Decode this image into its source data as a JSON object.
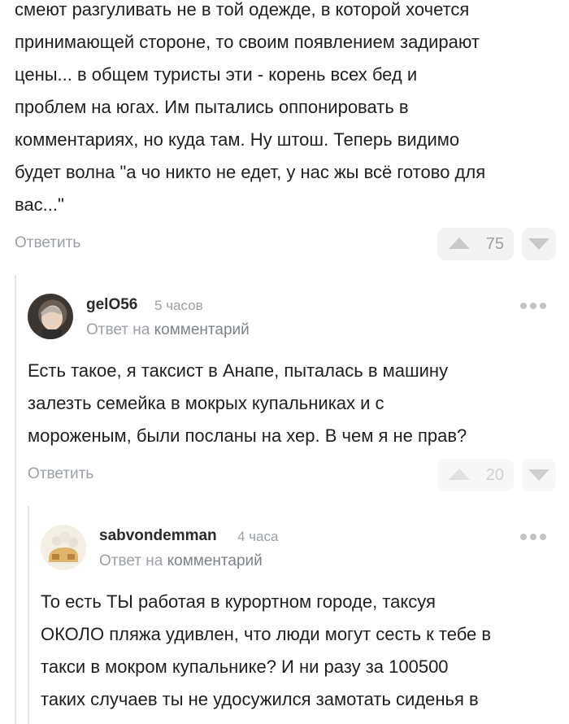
{
  "top_comment": {
    "lines": [
      "смеют разгуливать не в той одежде, в которой хочется",
      "принимающей стороне, то своим появлением задирают",
      "цены... в общем туристы эти - корень всех бед и",
      "проблем на югах. Им пытались оппонировать в",
      "комментариях, но куда там. Ну штош. Теперь видимо",
      "будет волна \"а чо никто не едет, у нас жы всё готово для",
      "вас...\""
    ],
    "reply_label": "Ответить",
    "votes": "75"
  },
  "comment1": {
    "username": "gelO56",
    "time": "5 часов",
    "reply_prefix": "Ответ на",
    "reply_target": "комментарий",
    "lines": [
      "Есть такое, я таксист в Анапе, пыталась в машину",
      "залезть семейка в мокрых купальниках и с",
      "мороженым, были посланы на хер. В чем я не прав?"
    ],
    "reply_label": "Ответить",
    "votes": "20"
  },
  "comment2": {
    "username": "sabvondemman",
    "time": "4 часа",
    "reply_prefix": "Ответ на",
    "reply_target": "комментарий",
    "lines": [
      "То есть ТЫ работая в курортном городе, таксуя",
      "ОКОЛО пляжа удивлен, что люди могут сесть к тебе в",
      "такси в мокром купальнике? И ни разу за 100500",
      "таких случаев ты не удосужился замотать сиденья в"
    ]
  },
  "colors": {
    "text": "#1f1f1f",
    "muted": "#9aa0a6",
    "vote_bg": "#f3f3f3",
    "thread_line": "#e6e6e6"
  }
}
